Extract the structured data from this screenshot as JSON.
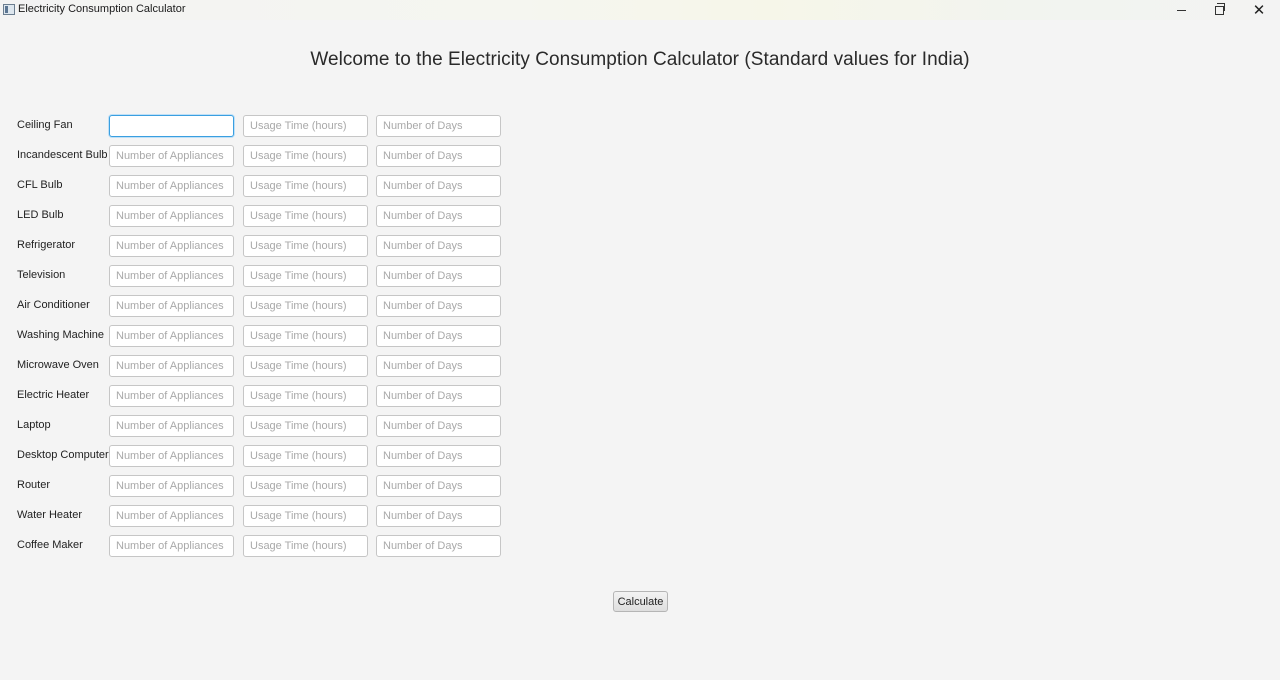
{
  "window": {
    "title": "Electricity Consumption Calculator",
    "controls": {
      "minimize_icon": "minimize-icon",
      "maximize_icon": "restore-icon",
      "close_icon": "close-icon"
    }
  },
  "heading": "Welcome to the Electricity Consumption Calculator (Standard values for India)",
  "placeholders": {
    "appliances": "Number of Appliances",
    "hours": "Usage Time (hours)",
    "days": "Number of Days"
  },
  "appliances": [
    {
      "label": "Ceiling Fan",
      "count": "",
      "hours": "",
      "days": ""
    },
    {
      "label": "Incandescent Bulb",
      "count": "",
      "hours": "",
      "days": ""
    },
    {
      "label": "CFL Bulb",
      "count": "",
      "hours": "",
      "days": ""
    },
    {
      "label": "LED Bulb",
      "count": "",
      "hours": "",
      "days": ""
    },
    {
      "label": "Refrigerator",
      "count": "",
      "hours": "",
      "days": ""
    },
    {
      "label": "Television",
      "count": "",
      "hours": "",
      "days": ""
    },
    {
      "label": "Air Conditioner",
      "count": "",
      "hours": "",
      "days": ""
    },
    {
      "label": "Washing Machine",
      "count": "",
      "hours": "",
      "days": ""
    },
    {
      "label": "Microwave Oven",
      "count": "",
      "hours": "",
      "days": ""
    },
    {
      "label": "Electric Heater",
      "count": "",
      "hours": "",
      "days": ""
    },
    {
      "label": "Laptop",
      "count": "",
      "hours": "",
      "days": ""
    },
    {
      "label": "Desktop Computer",
      "count": "",
      "hours": "",
      "days": ""
    },
    {
      "label": "Router",
      "count": "",
      "hours": "",
      "days": ""
    },
    {
      "label": "Water Heater",
      "count": "",
      "hours": "",
      "days": ""
    },
    {
      "label": "Coffee Maker",
      "count": "",
      "hours": "",
      "days": ""
    }
  ],
  "calculate_label": "Calculate",
  "colors": {
    "focus_accent": "#3a9fe0",
    "background": "#f4f4f4"
  }
}
